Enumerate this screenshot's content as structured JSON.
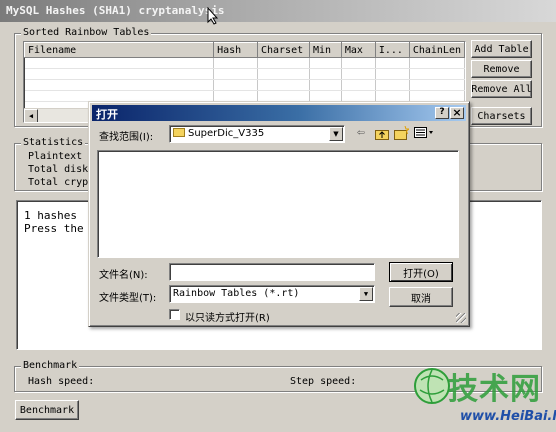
{
  "window": {
    "title": "MySQL Hashes (SHA1) cryptanalysis"
  },
  "sorted_tables": {
    "title": "Sorted Rainbow Tables",
    "columns": [
      "Filename",
      "Hash",
      "Charset",
      "Min",
      "Max",
      "I...",
      "ChainLen"
    ],
    "buttons": {
      "add": "Add Table",
      "remove": "Remove",
      "remove_all": "Remove All",
      "charsets": "Charsets"
    }
  },
  "statistics": {
    "title": "Statistics",
    "lines": [
      "Plaintext fo",
      "Total disk s",
      "Total crypto"
    ]
  },
  "log": {
    "lines": [
      "1 hashes",
      "Press the"
    ]
  },
  "benchmark": {
    "title": "Benchmark",
    "hash_speed_label": "Hash speed:",
    "step_speed_label": "Step speed:",
    "button": "Benchmark"
  },
  "dialog": {
    "title": "打开",
    "help_btn": "?",
    "close_btn": "×",
    "look_in_label": "查找范围(I):",
    "look_in_value": "SuperDic_V335",
    "filename_label": "文件名(N):",
    "filename_value": "",
    "filetype_label": "文件类型(T):",
    "filetype_value": "Rainbow Tables (*.rt)",
    "readonly_label": "以只读方式打开(R)",
    "open_button": "打开(O)",
    "cancel_button": "取消"
  },
  "watermark": {
    "main": "技术网",
    "url": "www.HeiBai.Net"
  },
  "colors": {
    "window_bg": "#d4d0c8",
    "dialog_title": "#0a246a",
    "watermark_green": "#2e9e3a",
    "watermark_blue": "#1f4fa8"
  }
}
